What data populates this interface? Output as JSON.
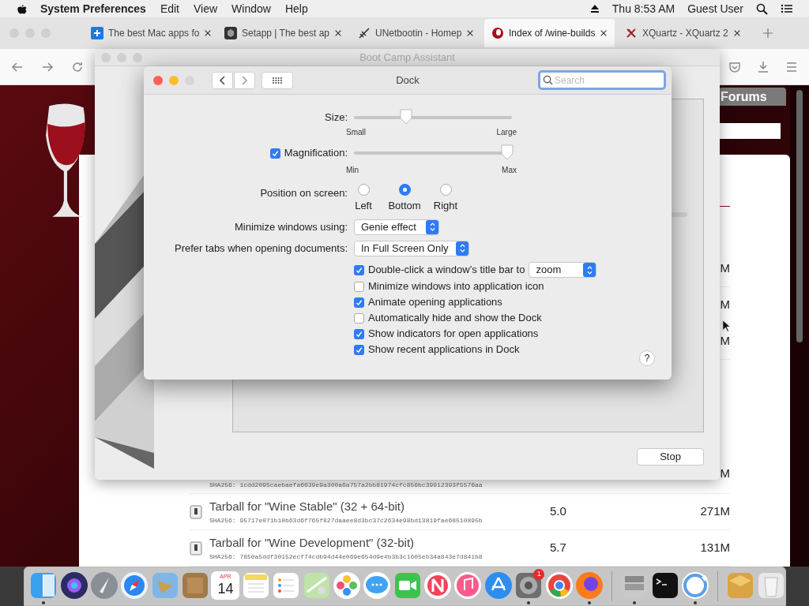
{
  "menu_bar": {
    "app_name": "System Preferences",
    "menus": [
      "Edit",
      "View",
      "Window",
      "Help"
    ],
    "clock": "Thu 8:53 AM",
    "user": "Guest User"
  },
  "browser": {
    "tabs": [
      {
        "kind": "grid",
        "title": "The best Mac apps fo",
        "selected": false
      },
      {
        "kind": "hexagon",
        "title": "Setapp | The best ap",
        "selected": false
      },
      {
        "kind": "plane",
        "title": "UNetbootin - Homep",
        "selected": false
      },
      {
        "kind": "wine",
        "title": "Index of /wine-builds",
        "selected": true
      },
      {
        "kind": "x",
        "title": "XQuartz - XQuartz 2",
        "selected": false
      }
    ],
    "page": {
      "nav_tab": "Forums",
      "sizes": [
        "M",
        "M",
        "M"
      ],
      "cut_row": {
        "hash": "SHA256: 1cdd2095caebaefa6639e9a300a6a757a2bb81974cfc856bc39912393f5576aa",
        "size": "M"
      },
      "rows": [
        {
          "title": "Tarball for \"Wine Stable\" (32 + 64-bit)",
          "hash": "SHA256: 95717e071b10b63d6f765f827daaee8d3bc37c2634e98bd13819fae68510895b",
          "version": "5.0",
          "size": "271M"
        },
        {
          "title": "Tarball for \"Wine Development\" (32-bit)",
          "hash": "SHA256: 7850a5ddf30152ecf74cdb94d44e069e654d9e4b3b3c1605eb34a843e7d841b8",
          "version": "5.7",
          "size": "131M"
        }
      ]
    }
  },
  "boot_camp": {
    "title": "Boot Camp Assistant",
    "stop_button": "Stop"
  },
  "dock_prefs": {
    "title": "Dock",
    "search": {
      "placeholder": "Search"
    },
    "size": {
      "label": "Size:",
      "level": 0.33,
      "min_label": "Small",
      "max_label": "Large"
    },
    "magnification": {
      "label": "Magnification:",
      "checked": true,
      "level": 0.97,
      "min_label": "Min",
      "max_label": "Max"
    },
    "position": {
      "label": "Position on screen:",
      "options": [
        {
          "label": "Left",
          "selected": false
        },
        {
          "label": "Bottom",
          "selected": true
        },
        {
          "label": "Right",
          "selected": false
        }
      ]
    },
    "minimize": {
      "label": "Minimize windows using:",
      "value": "Genie effect"
    },
    "prefer_tabs": {
      "label": "Prefer tabs when opening documents:",
      "value": "In Full Screen Only"
    },
    "options": [
      {
        "label": "Double-click a window’s title bar to",
        "checked": true,
        "popup": "zoom"
      },
      {
        "label": "Minimize windows into application icon",
        "checked": false
      },
      {
        "label": "Animate opening applications",
        "checked": true
      },
      {
        "label": "Automatically hide and show the Dock",
        "checked": false
      },
      {
        "label": "Show indicators for open applications",
        "checked": true
      },
      {
        "label": "Show recent applications in Dock",
        "checked": true
      }
    ],
    "help": "?"
  },
  "dock": {
    "apps": [
      {
        "kind": "finder",
        "running": true
      },
      {
        "kind": "siri",
        "running": false
      },
      {
        "kind": "launchpad",
        "running": false
      },
      {
        "kind": "safari",
        "running": false
      },
      {
        "kind": "mail",
        "running": false
      },
      {
        "kind": "notebook",
        "running": false
      },
      {
        "kind": "calendar",
        "month": "APR",
        "day": "14",
        "running": false
      },
      {
        "kind": "notes",
        "running": false
      },
      {
        "kind": "reminders",
        "running": false
      },
      {
        "kind": "maps",
        "running": false
      },
      {
        "kind": "photos",
        "running": false
      },
      {
        "kind": "messages",
        "running": false
      },
      {
        "kind": "facetime",
        "running": false
      },
      {
        "kind": "news",
        "running": false
      },
      {
        "kind": "music",
        "running": false
      },
      {
        "kind": "appstore",
        "running": false
      },
      {
        "kind": "settings",
        "badge": "1",
        "running": true
      },
      {
        "kind": "chrome",
        "running": false
      },
      {
        "kind": "firefox",
        "running": true
      },
      {
        "kind": "separator"
      },
      {
        "kind": "bootcamp",
        "running": true
      },
      {
        "kind": "terminal",
        "running": false
      },
      {
        "kind": "ring",
        "running": true
      },
      {
        "kind": "separator"
      },
      {
        "kind": "package",
        "running": false
      },
      {
        "kind": "trash",
        "running": false
      }
    ]
  }
}
